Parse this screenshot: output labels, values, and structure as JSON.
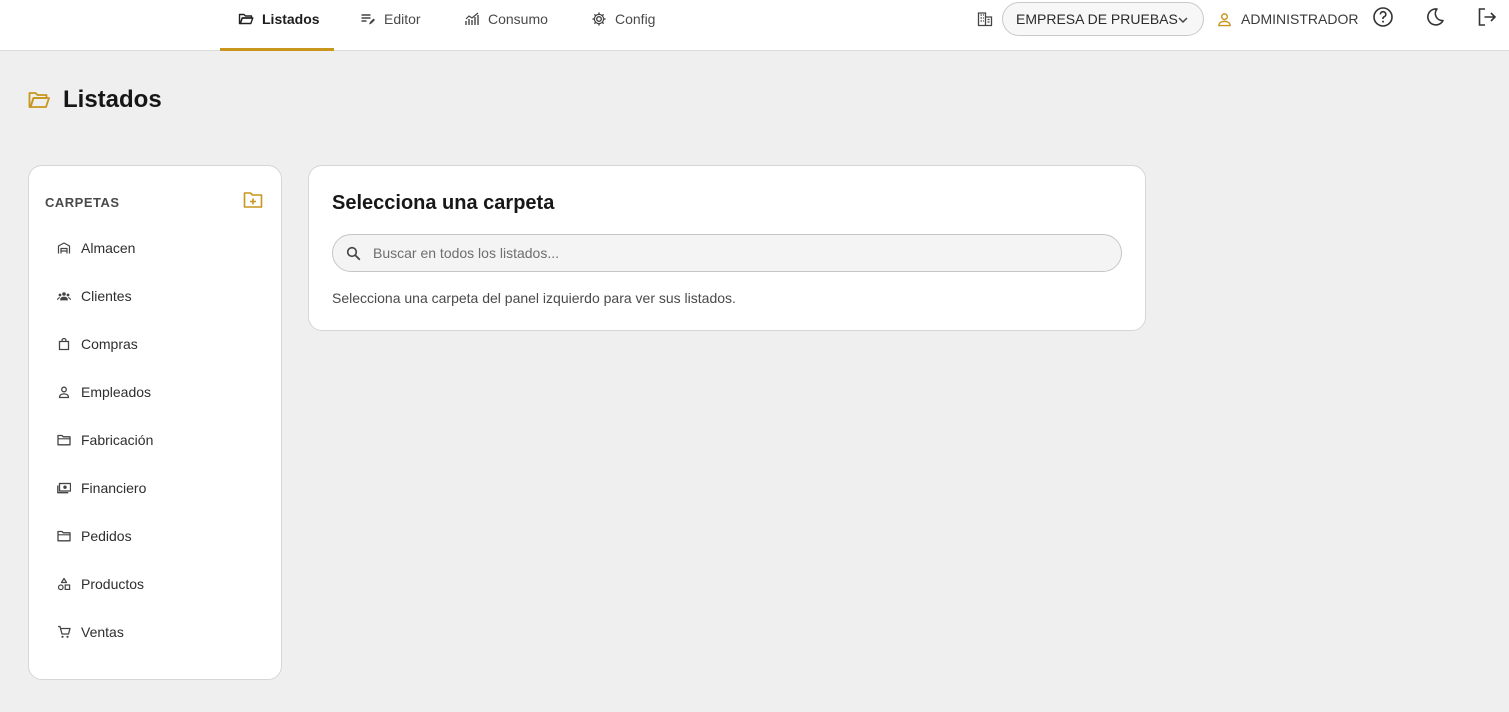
{
  "nav": {
    "tabs": [
      {
        "label": "Listados",
        "icon": "folder-open-icon",
        "active": true
      },
      {
        "label": "Editor",
        "icon": "edit-list-icon",
        "active": false
      },
      {
        "label": "Consumo",
        "icon": "chart-icon",
        "active": false
      },
      {
        "label": "Config",
        "icon": "gear-icon",
        "active": false
      }
    ]
  },
  "header": {
    "company_selected": "EMPRESA DE PRUEBAS",
    "user_name": "ADMINISTRADOR"
  },
  "page": {
    "title": "Listados"
  },
  "sidebar": {
    "heading": "CARPETAS",
    "items": [
      {
        "label": "Almacen",
        "icon": "warehouse-icon"
      },
      {
        "label": "Clientes",
        "icon": "groups-icon"
      },
      {
        "label": "Compras",
        "icon": "shopping-bag-icon"
      },
      {
        "label": "Empleados",
        "icon": "person-icon"
      },
      {
        "label": "Fabricación",
        "icon": "folder-icon"
      },
      {
        "label": "Financiero",
        "icon": "money-icon"
      },
      {
        "label": "Pedidos",
        "icon": "folder-icon"
      },
      {
        "label": "Productos",
        "icon": "category-icon"
      },
      {
        "label": "Ventas",
        "icon": "cart-icon"
      }
    ]
  },
  "main": {
    "title": "Selecciona una carpeta",
    "search_placeholder": "Buscar en todos los listados...",
    "hint": "Selecciona una carpeta del panel izquierdo para ver sus listados."
  },
  "colors": {
    "accent": "#c8961c",
    "background": "#efefef",
    "card": "#ffffff"
  }
}
